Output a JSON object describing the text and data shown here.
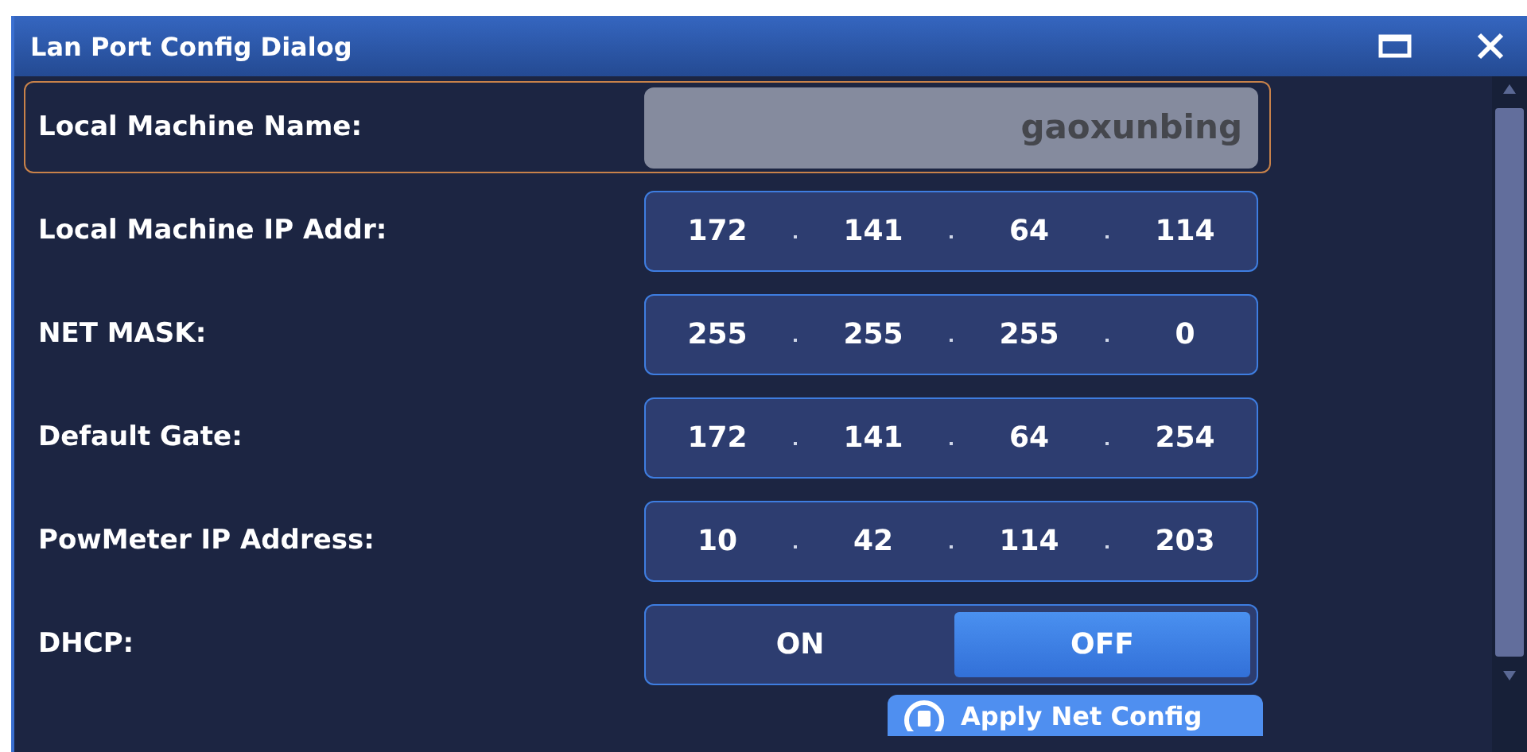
{
  "window": {
    "title": "Lan Port Config Dialog"
  },
  "rows": [
    {
      "kind": "text",
      "label": "Local Machine Name:",
      "value": "gaoxunbing",
      "disabled": true,
      "focused": true
    },
    {
      "kind": "ip",
      "label": "Local Machine IP Addr:",
      "octets": [
        "172",
        "141",
        "64",
        "114"
      ],
      "focused": false
    },
    {
      "kind": "ip",
      "label": "NET MASK:",
      "octets": [
        "255",
        "255",
        "255",
        "0"
      ],
      "focused": false
    },
    {
      "kind": "ip",
      "label": "Default Gate:",
      "octets": [
        "172",
        "141",
        "64",
        "254"
      ],
      "focused": false
    },
    {
      "kind": "ip",
      "label": "PowMeter IP Address:",
      "octets": [
        "10",
        "42",
        "114",
        "203"
      ],
      "focused": false
    },
    {
      "kind": "toggle",
      "label": "DHCP:",
      "options": [
        {
          "label": "ON",
          "selected": false
        },
        {
          "label": "OFF",
          "selected": true
        }
      ],
      "focused": false
    }
  ],
  "apply_button": {
    "label": "Apply Net Config"
  }
}
